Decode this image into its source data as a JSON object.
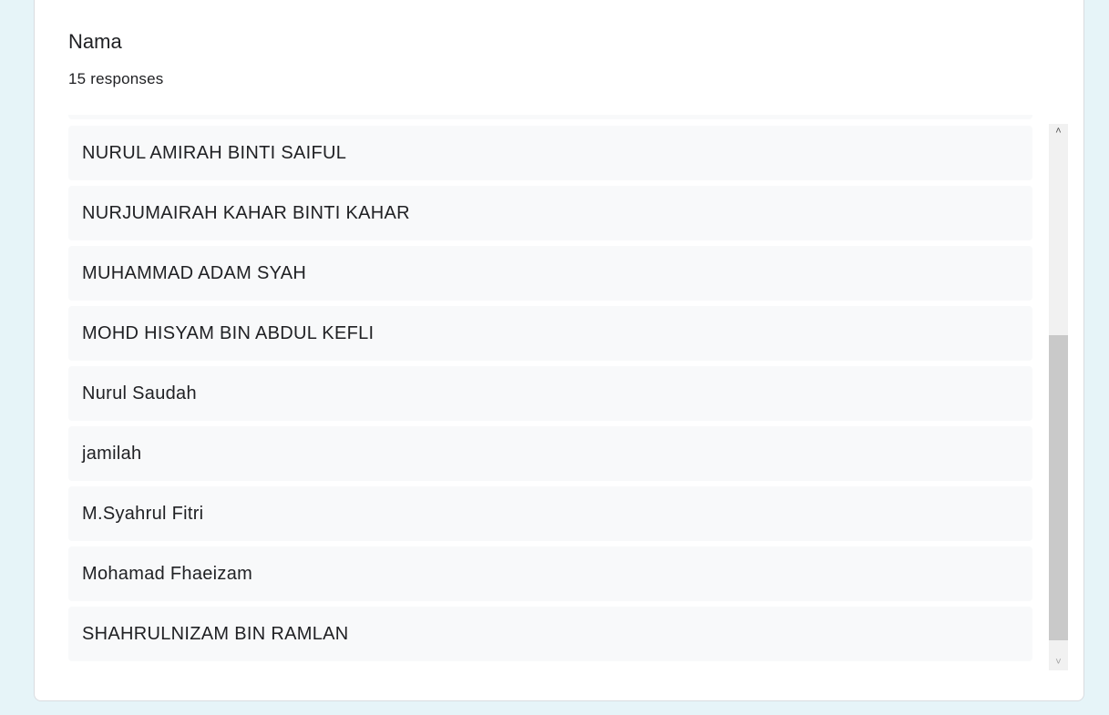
{
  "question": {
    "title": "Nama",
    "response_count": "15 responses"
  },
  "responses": [
    "NURUL AMIRAH BINTI SAIFUL",
    "NURJUMAIRAH KAHAR BINTI KAHAR",
    "MUHAMMAD ADAM SYAH",
    "MOHD HISYAM BIN ABDUL KEFLI",
    "Nurul Saudah",
    "jamilah",
    "M.Syahrul Fitri",
    "Mohamad Fhaeizam",
    "SHAHRULNIZAM BIN RAMLAN"
  ],
  "scrollbar": {
    "up_arrow": "˄",
    "down_arrow": "˅",
    "scroll_position_fraction": 1.0
  },
  "colors": {
    "page_background": "#e6f4f8",
    "card_background": "#ffffff",
    "item_background": "#f8f9fa",
    "text": "#202124"
  }
}
